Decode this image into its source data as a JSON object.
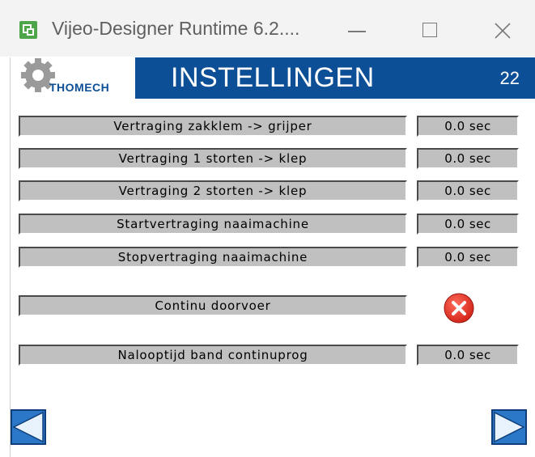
{
  "window": {
    "title": "Vijeo-Designer Runtime 6.2...."
  },
  "header": {
    "logo_text": "THOMECH",
    "title": "INSTELLINGEN",
    "page_number": "22",
    "color": "#0d4f96"
  },
  "settings": [
    {
      "label": "Vertraging zakklem -> grijper",
      "value": "0.0 sec"
    },
    {
      "label": "Vertraging 1 storten -> klep",
      "value": "0.0 sec"
    },
    {
      "label": "Vertraging 2 storten -> klep",
      "value": "0.0 sec"
    },
    {
      "label": "Startvertraging naaimachine",
      "value": "0.0 sec"
    },
    {
      "label": "Stopvertraging naaimachine",
      "value": "0.0 sec"
    },
    {
      "label": "Continu doorvoer",
      "status_icon": "red-x-circle-icon",
      "status": "off"
    },
    {
      "label": "Nalooptijd band continuprog",
      "value": "0.0 sec"
    }
  ],
  "navigation": {
    "prev_icon": "arrow-left-icon",
    "next_icon": "arrow-right-icon"
  }
}
